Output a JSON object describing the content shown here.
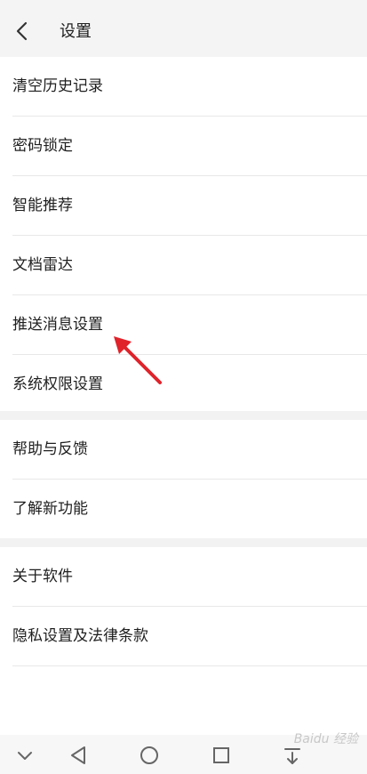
{
  "header": {
    "title": "设置",
    "back_icon": "chevron-left-icon"
  },
  "section1": {
    "items": [
      {
        "label": "清空历史记录"
      },
      {
        "label": "密码锁定"
      },
      {
        "label": "智能推荐"
      },
      {
        "label": "文档雷达"
      },
      {
        "label": "推送消息设置"
      },
      {
        "label": "系统权限设置"
      }
    ]
  },
  "section2": {
    "items": [
      {
        "label": "帮助与反馈"
      },
      {
        "label": "了解新功能"
      }
    ]
  },
  "section3": {
    "items": [
      {
        "label": "关于软件"
      },
      {
        "label": "隐私设置及法律条款"
      }
    ]
  },
  "annotation": {
    "arrow_color": "#e0232b"
  },
  "navbar": {
    "icons": [
      "chevron-down-icon",
      "back-triangle-icon",
      "home-circle-icon",
      "recents-square-icon",
      "download-icon"
    ]
  },
  "watermark": {
    "text": "Baidu 经验"
  }
}
